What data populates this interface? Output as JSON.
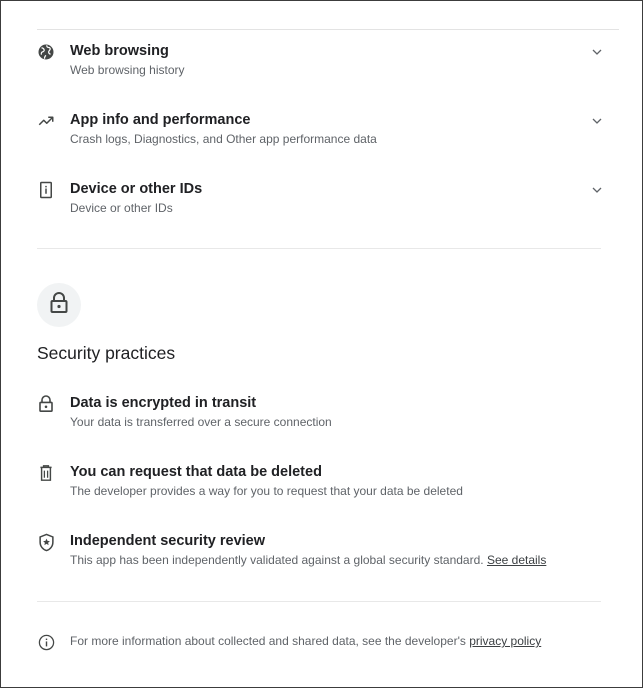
{
  "data_types": [
    {
      "title": "Web browsing",
      "subtitle": "Web browsing history",
      "icon": "globe-icon"
    },
    {
      "title": "App info and performance",
      "subtitle": "Crash logs, Diagnostics, and Other app performance data",
      "icon": "performance-icon"
    },
    {
      "title": "Device or other IDs",
      "subtitle": "Device or other IDs",
      "icon": "device-id-icon"
    }
  ],
  "security": {
    "heading": "Security practices",
    "icon": "lock-icon",
    "items": [
      {
        "title": "Data is encrypted in transit",
        "subtitle": "Your data is transferred over a secure connection",
        "icon": "lock-icon"
      },
      {
        "title": "You can request that data be deleted",
        "subtitle": "The developer provides a way for you to request that your data be deleted",
        "icon": "trash-icon"
      },
      {
        "title": "Independent security review",
        "subtitle": "This app has been independently validated against a global security standard.",
        "link": "See details",
        "icon": "shield-star-icon"
      }
    ]
  },
  "footer": {
    "text": "For more information about collected and shared data, see the developer's",
    "link": "privacy policy",
    "icon": "info-icon"
  },
  "colors": {
    "text_primary": "#202124",
    "text_secondary": "#5f6368",
    "icon": "#444746",
    "divider": "#e8e8e8",
    "icon_circle_bg": "#f1f3f4"
  }
}
